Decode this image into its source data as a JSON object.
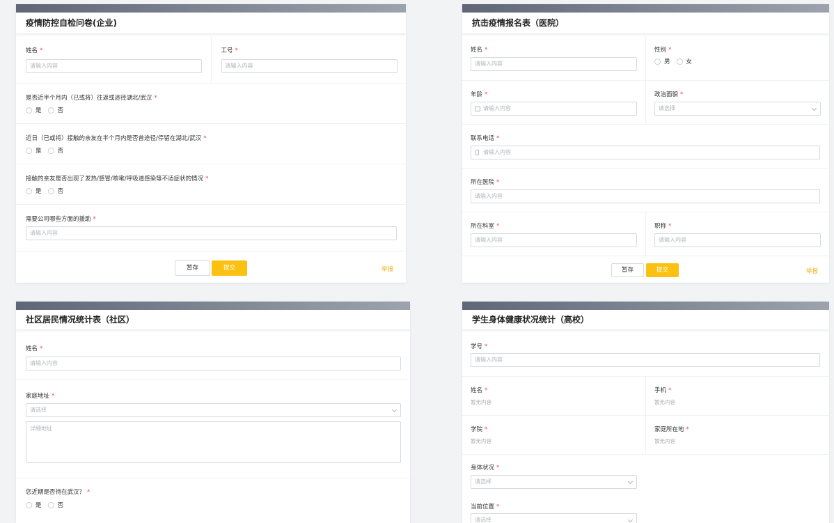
{
  "colors": {
    "accent": "#fbc110",
    "required": "#e94848",
    "header_bar": "#5f6678"
  },
  "common": {
    "required_mark": "*",
    "placeholder_input": "请输入内容",
    "placeholder_select": "请选择",
    "placeholder_detail": "详细地址",
    "empty_value": "暂无内容",
    "save_label": "暂存",
    "submit_label": "提交",
    "report_label": "举报",
    "yes": "是",
    "no": "否",
    "male": "男",
    "female": "女"
  },
  "form1": {
    "title": "疫情防控自检问卷(企业)",
    "name_label": "姓名",
    "id_label": "工号",
    "q1": "是否近半个月内（已或将）往返或途径湖北/武汉",
    "q2": "近日（已或将）接触的亲友在半个月内是否曾途径/停留在湖北/武汉",
    "q3": "接触的亲友是否出现了发热/感冒/咳嗽/呼吸道感染等不适症状的情况",
    "q4": "需要公司哪些方面的援助"
  },
  "form2": {
    "title": "抗击疫情报名表（医院）",
    "name_label": "姓名",
    "gender_label": "性别",
    "age_label": "年龄",
    "politics_label": "政治面貌",
    "phone_label": "联系电话",
    "hospital_label": "所在医院",
    "dept_label": "所在科室",
    "rank_label": "职称"
  },
  "form3": {
    "title": "社区居民情况统计表（社区）",
    "name_label": "姓名",
    "address_label": "家庭地址",
    "wuhan_label": "您近期是否待在武汉？"
  },
  "form4": {
    "title": "学生身体健康状况统计（高校）",
    "student_id_label": "学号",
    "name_label": "姓名",
    "mobile_label": "手机",
    "college_label": "学院",
    "home_label": "家庭所在地",
    "health_label": "身体状况",
    "location_label": "当前位置"
  }
}
